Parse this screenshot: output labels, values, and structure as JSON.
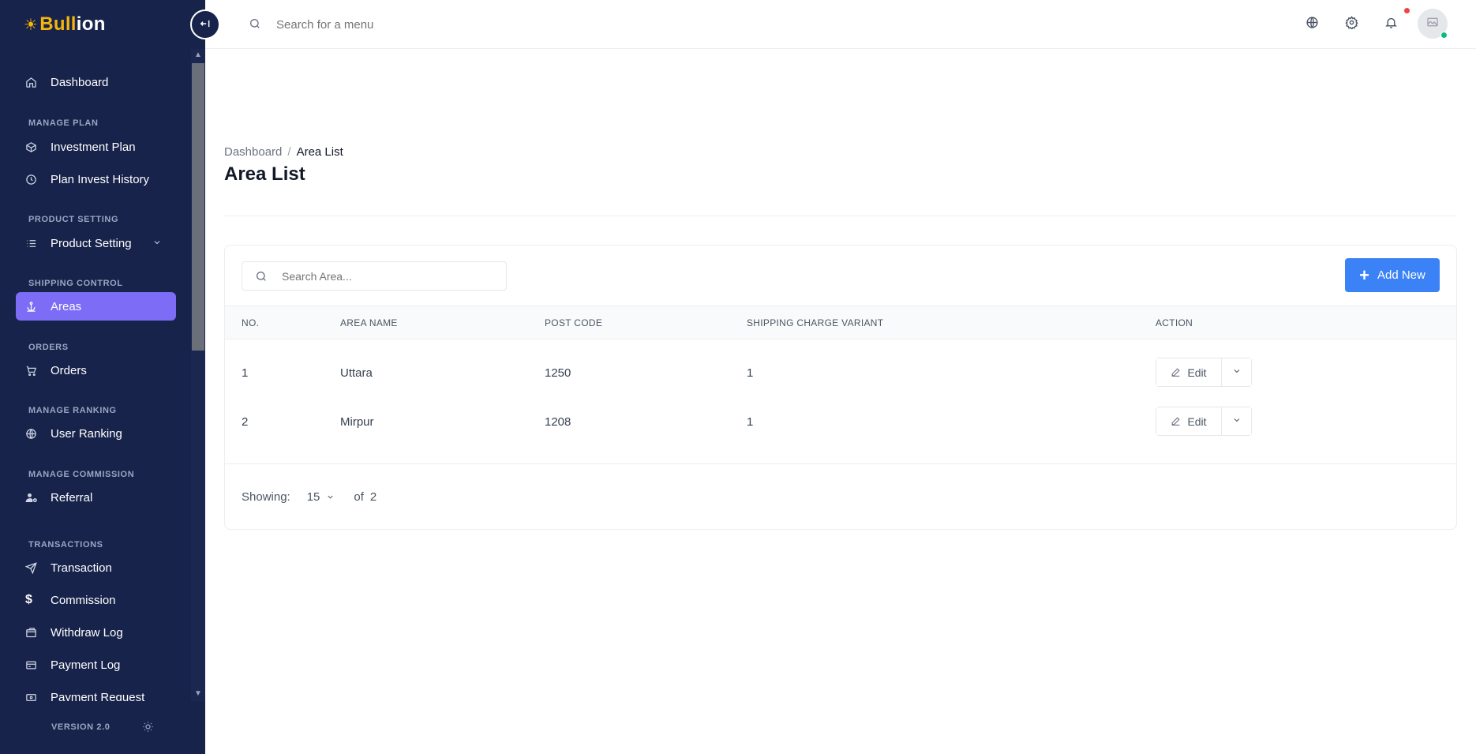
{
  "brand": {
    "part1": "Bull",
    "part2": "ion"
  },
  "sidebar": {
    "items": [
      {
        "label": "Dashboard",
        "icon": "home-icon"
      },
      {
        "section": "MANAGE PLAN"
      },
      {
        "label": "Investment Plan",
        "icon": "box-icon"
      },
      {
        "label": "Plan Invest History",
        "icon": "clock-icon"
      },
      {
        "section": "PRODUCT SETTING"
      },
      {
        "label": "Product Setting",
        "icon": "list-icon"
      },
      {
        "section": "SHIPPING CONTROL"
      },
      {
        "label": "Areas",
        "icon": "anchor-icon"
      },
      {
        "section": "ORDERS"
      },
      {
        "label": "Orders",
        "icon": "cart-icon"
      },
      {
        "section": "MANAGE RANKING"
      },
      {
        "label": "User Ranking",
        "icon": "globe-icon"
      },
      {
        "section": "MANAGE COMMISSION"
      },
      {
        "label": "Referral",
        "icon": "user-gear-icon"
      },
      {
        "section": "TRANSACTIONS"
      },
      {
        "label": "Transaction",
        "icon": "send-icon"
      },
      {
        "label": "Commission",
        "icon": "dollar-icon"
      },
      {
        "label": "Withdraw Log",
        "icon": "wallet-icon"
      },
      {
        "label": "Payment Log",
        "icon": "card-icon"
      },
      {
        "label": "Payment Request",
        "icon": "cash-icon"
      }
    ],
    "active": "Areas",
    "version": "VERSION 2.0"
  },
  "header": {
    "search_placeholder": "Search for a menu"
  },
  "breadcrumb": {
    "root": "Dashboard",
    "separator": "/",
    "current": "Area List"
  },
  "page": {
    "title": "Area List"
  },
  "toolbar": {
    "search_placeholder": "Search Area...",
    "add_label": "Add New"
  },
  "table": {
    "headers": [
      "NO.",
      "AREA NAME",
      "POST CODE",
      "SHIPPING CHARGE VARIANT",
      "ACTION"
    ],
    "rows": [
      {
        "no": "1",
        "area": "Uttara",
        "post": "1250",
        "variant": "1",
        "action": "Edit"
      },
      {
        "no": "2",
        "area": "Mirpur",
        "post": "1208",
        "variant": "1",
        "action": "Edit"
      }
    ]
  },
  "pagination": {
    "label": "Showing:",
    "per_page": "15",
    "of": "of",
    "total": "2"
  },
  "colors": {
    "sidebar_bg": "#17234a",
    "active_item": "#7c6cf6",
    "primary": "#3b82f6",
    "brand_gold": "#f5b50c"
  }
}
